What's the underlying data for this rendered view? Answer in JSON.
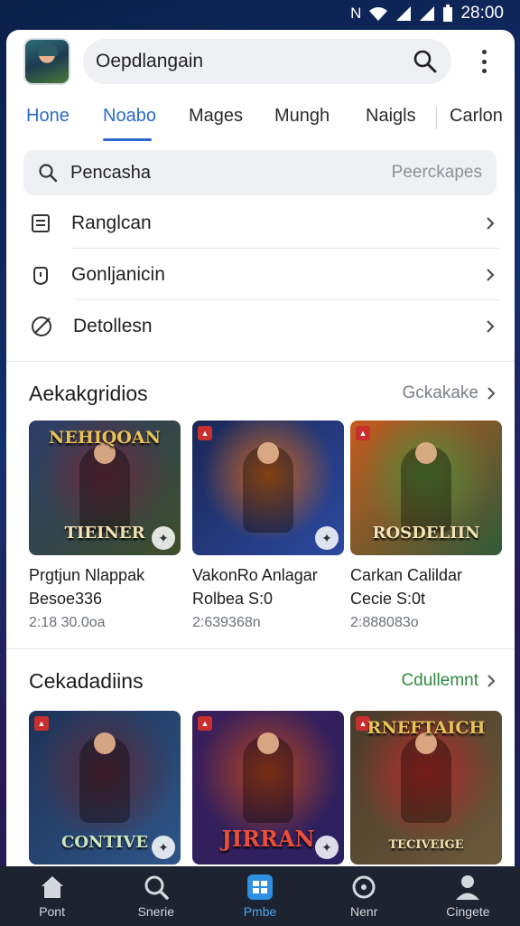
{
  "status_bar": {
    "time": "28:00"
  },
  "topbar": {
    "search_text": "Oepdlangain"
  },
  "tabs": [
    "Hone",
    "Noabo",
    "Mages",
    "Mungh",
    "Naigls",
    "Carlon"
  ],
  "search": {
    "text": "Pencasha",
    "hint": "Peerckapes"
  },
  "menu": [
    {
      "label": "Ranglcan",
      "icon": "document-icon"
    },
    {
      "label": "Gonljanicin",
      "icon": "shield-icon"
    },
    {
      "label": "Detollesn",
      "icon": "slash-circle-icon"
    }
  ],
  "sections": [
    {
      "title": "Aekakgridios",
      "more": "Gckakake",
      "cards": [
        {
          "art_title": "NEHIQOAN",
          "art_sub": "TIEINER",
          "name": "Prgtjun Nlappak",
          "line2": "Besoe336",
          "meta": "2:18 30.0oa",
          "colors": [
            "#2b3d6a",
            "#6b2b3f",
            "#3e4f2a"
          ]
        },
        {
          "art_title": "",
          "art_sub": "",
          "name": "VakonRo Anlagar",
          "line2": "Rolbea S:0",
          "meta": "2:639368n",
          "colors": [
            "#1a2755",
            "#c8641e",
            "#2c4aa0"
          ]
        },
        {
          "art_title": "",
          "art_sub": "ROSDELIIN",
          "name": "Carkan Calildar",
          "line2": "Cecie S:0t",
          "meta": "2:888083o",
          "colors": [
            "#c65b1e",
            "#5a8a3a",
            "#2f5a3a"
          ]
        }
      ]
    },
    {
      "title": "Cekadadiins",
      "more": "Cdullemnt",
      "cards": [
        {
          "art_title": "",
          "art_sub": "CONTIVE",
          "colors": [
            "#1d3357",
            "#5b2a3a",
            "#2f5588"
          ]
        },
        {
          "art_title": "",
          "art_sub": "JIRRAN",
          "colors": [
            "#3a1f5a",
            "#b8451e",
            "#2a2060"
          ]
        },
        {
          "art_title": "RNEFTAICH",
          "art_sub": "TECIVEIGE",
          "colors": [
            "#4a3a2a",
            "#b52a2a",
            "#6b5a3a"
          ]
        }
      ]
    }
  ],
  "bottom_nav": [
    {
      "label": "Pont",
      "icon": "home-icon"
    },
    {
      "label": "Snerie",
      "icon": "search-icon"
    },
    {
      "label": "Pmbe",
      "icon": "grid-icon"
    },
    {
      "label": "Nenr",
      "icon": "refresh-icon"
    },
    {
      "label": "Cingete",
      "icon": "profile-icon"
    }
  ]
}
